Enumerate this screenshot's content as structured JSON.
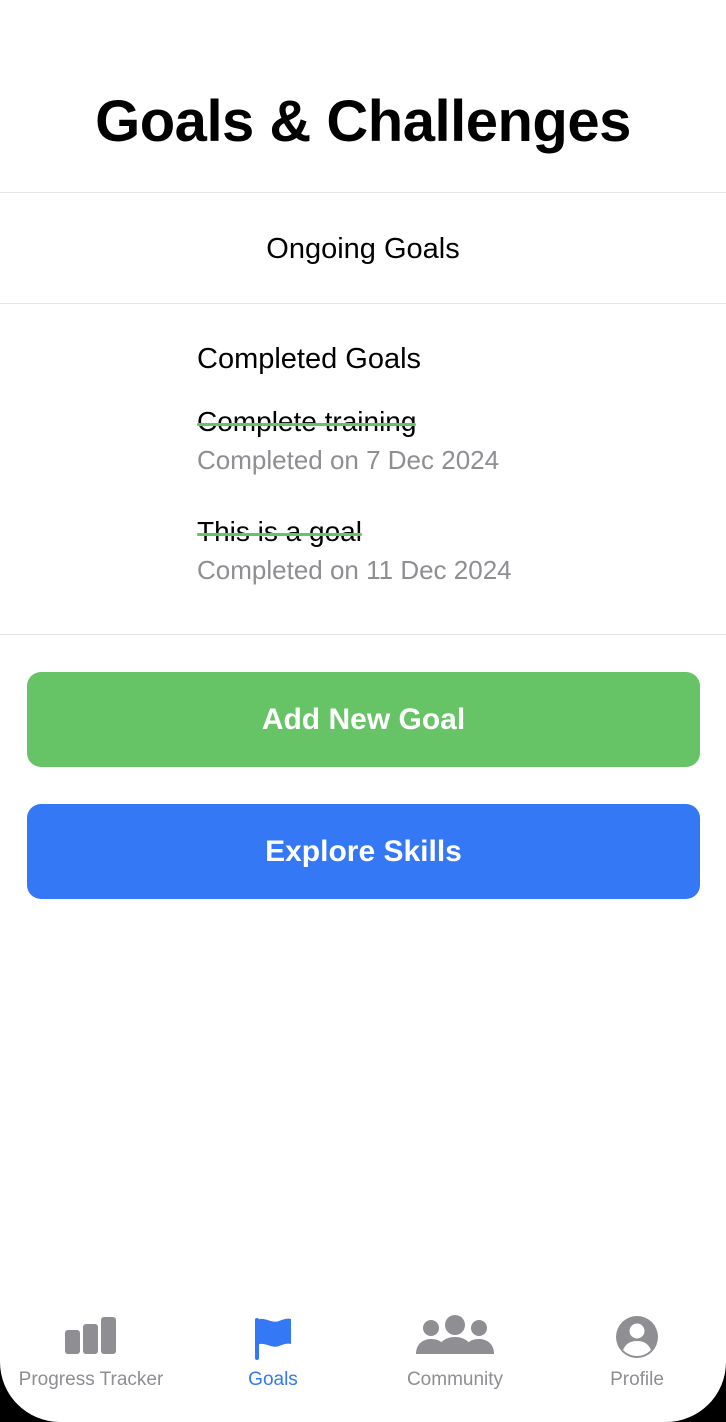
{
  "header": {
    "title": "Goals & Challenges"
  },
  "ongoing": {
    "heading": "Ongoing Goals"
  },
  "completed": {
    "heading": "Completed Goals",
    "items": [
      {
        "name": "Complete training",
        "date": "Completed on 7 Dec 2024"
      },
      {
        "name": "This is a goal",
        "date": "Completed on 11 Dec 2024"
      }
    ]
  },
  "actions": {
    "add_goal_label": "Add New Goal",
    "explore_skills_label": "Explore Skills"
  },
  "tabbar": {
    "tabs": [
      {
        "label": "Progress Tracker",
        "icon": "bar-chart-icon",
        "active": false
      },
      {
        "label": "Goals",
        "icon": "flag-icon",
        "active": true
      },
      {
        "label": "Community",
        "icon": "people-icon",
        "active": false
      },
      {
        "label": "Profile",
        "icon": "person-circle-icon",
        "active": false
      }
    ]
  },
  "colors": {
    "accent_green": "#66c466",
    "accent_blue": "#3478f6",
    "inactive_gray": "#8e8e93"
  }
}
